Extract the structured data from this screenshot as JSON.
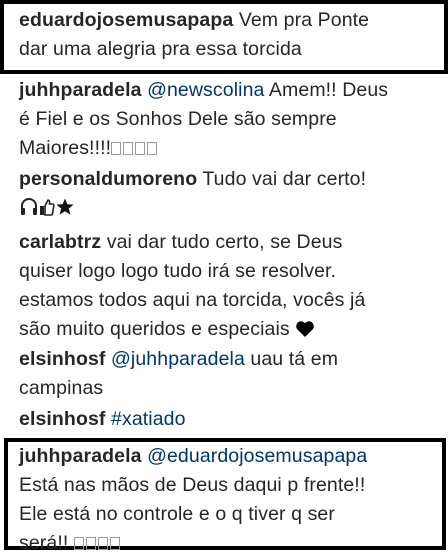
{
  "comments": [
    {
      "username": "eduardojosemusapapa",
      "lines": [
        "Vem pra Ponte",
        "dar uma alegria pra essa torcida"
      ]
    },
    {
      "username": "juhhparadela",
      "mention": "@newscolina",
      "lines": [
        "Amem!! Deus",
        "é Fiel e os Sonhos Dele são sempre",
        "Maiores!!!!"
      ],
      "trailing_glyphs": 4
    },
    {
      "username": "personaldumoreno",
      "lines": [
        "Tudo vai dar certo!"
      ],
      "emojis": [
        "headphones-icon",
        "thumbs-up-icon",
        "star-icon"
      ]
    },
    {
      "username": "carlabtrz",
      "lines": [
        "vai dar tudo certo, se Deus",
        "quiser logo logo tudo irá se resolver.",
        "estamos todos aqui na torcida, vocês já",
        "são muito queridos e especiais"
      ],
      "emojis": [
        "heart-icon"
      ]
    },
    {
      "username": "elsinhosf",
      "mention": "@juhhparadela",
      "lines": [
        "uau tá em",
        "campinas"
      ]
    },
    {
      "username": "elsinhosf",
      "hashtag": "#xatiado"
    },
    {
      "username": "juhhparadela",
      "mention": "@eduardojosemusapapa",
      "lines": [
        "Está nas mãos de Deus daqui p frente!!",
        "Ele está no controle e o q tiver q ser",
        "será!!"
      ],
      "trailing_glyphs": 4
    }
  ]
}
